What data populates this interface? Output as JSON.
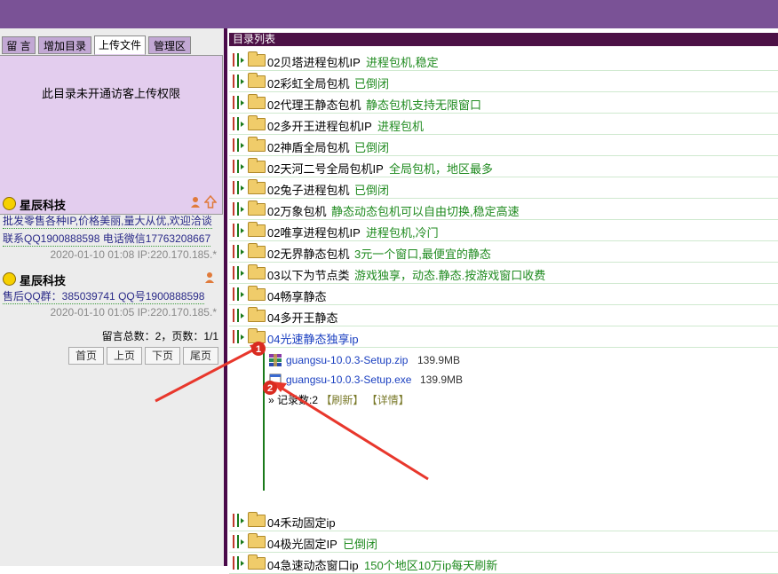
{
  "top_bar": {
    "title_left": "",
    "title_right": ""
  },
  "tabs": [
    {
      "label": "留 言"
    },
    {
      "label": "增加目录"
    },
    {
      "label": "上传文件"
    },
    {
      "label": "管理区"
    }
  ],
  "upload_notice": "此目录未开通访客上传权限",
  "posts": [
    {
      "name": "星辰科技",
      "lines": [
        "批发零售各种IP,价格美丽,量大从优,欢迎洽谈",
        "联系QQ1900888598  电话微信17763208667"
      ],
      "meta": "2020-01-10 01:08 IP:220.170.185.*"
    },
    {
      "name": "星辰科技",
      "lines": [
        "售后QQ群：385039741  QQ号1900888598"
      ],
      "meta": "2020-01-10 01:05 IP:220.170.185.*"
    }
  ],
  "pagination": {
    "stats": "留言总数：2，页数：1/1",
    "first": "首页",
    "prev": "上页",
    "next": "下页",
    "last": "尾页"
  },
  "dir_header": "目录列表",
  "directories": [
    {
      "name": "02贝塔进程包机IP",
      "desc": "进程包机,稳定"
    },
    {
      "name": "02彩虹全局包机",
      "desc": "已倒闭"
    },
    {
      "name": "02代理王静态包机",
      "desc": "静态包机支持无限窗口"
    },
    {
      "name": "02多开王进程包机IP",
      "desc": "进程包机"
    },
    {
      "name": "02神盾全局包机",
      "desc": "已倒闭"
    },
    {
      "name": "02天河二号全局包机IP",
      "desc": "全局包机，地区最多"
    },
    {
      "name": "02兔子进程包机",
      "desc": "已倒闭"
    },
    {
      "name": "02万象包机",
      "desc": "静态动态包机可以自由切换,稳定高速"
    },
    {
      "name": "02唯享进程包机IP",
      "desc": "进程包机,冷门"
    },
    {
      "name": "02无界静态包机",
      "desc": "3元一个窗口,最便宜的静态"
    },
    {
      "name": "03以下为节点类",
      "desc": "游戏独享，动态.静态.按游戏窗口收费"
    },
    {
      "name": "04畅享静态",
      "desc": ""
    },
    {
      "name": "04多开王静态",
      "desc": ""
    },
    {
      "name": "04光速静态独享ip",
      "desc": ""
    }
  ],
  "files": [
    {
      "name": "guangsu-10.0.3-Setup.zip",
      "size": "139.9MB",
      "icon": "archive-icon"
    },
    {
      "name": "guangsu-10.0.3-Setup.exe",
      "size": "139.9MB",
      "icon": "exe-icon"
    }
  ],
  "records": {
    "label": "记录数:2",
    "refresh": "【刷新】",
    "details": "【详情】"
  },
  "directories_after": [
    {
      "name": "04禾动固定ip",
      "desc": ""
    },
    {
      "name": "04极光固定IP",
      "desc": "已倒闭"
    },
    {
      "name": "04急速动态窗口ip",
      "desc": "150个地区10万ip每天刷新"
    }
  ],
  "annotations": {
    "marker1": "1",
    "marker2": "2"
  },
  "colors": {
    "accent": "#7a5296",
    "header": "#4c1146",
    "desc_green": "#1e8a1e",
    "link_blue": "#1a3fc0",
    "arrow_red": "#e8372c"
  }
}
